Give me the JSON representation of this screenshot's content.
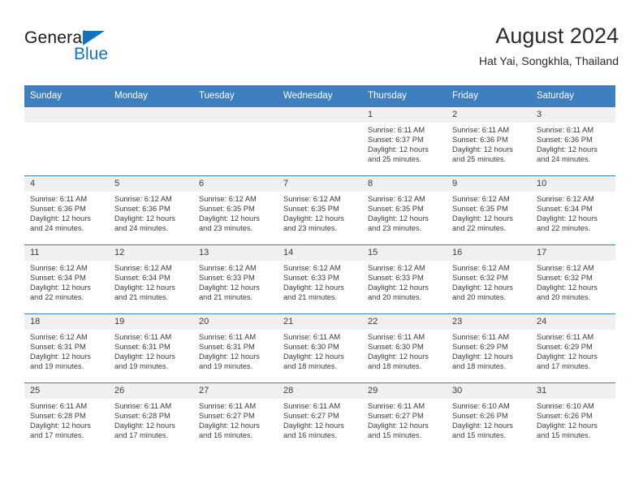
{
  "brand": {
    "name_top": "General",
    "name_bottom": "Blue",
    "accent_color": "#1573be",
    "triangle_icon": "triangle-icon"
  },
  "header": {
    "title": "August 2024",
    "subtitle": "Hat Yai, Songkhla, Thailand"
  },
  "calendar": {
    "header_bg": "#3d7fbf",
    "daynum_bg": "#f0f0f0",
    "weekdays": [
      "Sunday",
      "Monday",
      "Tuesday",
      "Wednesday",
      "Thursday",
      "Friday",
      "Saturday"
    ],
    "weeks": [
      [
        {
          "day": "",
          "lines": []
        },
        {
          "day": "",
          "lines": []
        },
        {
          "day": "",
          "lines": []
        },
        {
          "day": "",
          "lines": []
        },
        {
          "day": "1",
          "lines": [
            "Sunrise: 6:11 AM",
            "Sunset: 6:37 PM",
            "Daylight: 12 hours",
            "and 25 minutes."
          ]
        },
        {
          "day": "2",
          "lines": [
            "Sunrise: 6:11 AM",
            "Sunset: 6:36 PM",
            "Daylight: 12 hours",
            "and 25 minutes."
          ]
        },
        {
          "day": "3",
          "lines": [
            "Sunrise: 6:11 AM",
            "Sunset: 6:36 PM",
            "Daylight: 12 hours",
            "and 24 minutes."
          ]
        }
      ],
      [
        {
          "day": "4",
          "lines": [
            "Sunrise: 6:11 AM",
            "Sunset: 6:36 PM",
            "Daylight: 12 hours",
            "and 24 minutes."
          ]
        },
        {
          "day": "5",
          "lines": [
            "Sunrise: 6:12 AM",
            "Sunset: 6:36 PM",
            "Daylight: 12 hours",
            "and 24 minutes."
          ]
        },
        {
          "day": "6",
          "lines": [
            "Sunrise: 6:12 AM",
            "Sunset: 6:35 PM",
            "Daylight: 12 hours",
            "and 23 minutes."
          ]
        },
        {
          "day": "7",
          "lines": [
            "Sunrise: 6:12 AM",
            "Sunset: 6:35 PM",
            "Daylight: 12 hours",
            "and 23 minutes."
          ]
        },
        {
          "day": "8",
          "lines": [
            "Sunrise: 6:12 AM",
            "Sunset: 6:35 PM",
            "Daylight: 12 hours",
            "and 23 minutes."
          ]
        },
        {
          "day": "9",
          "lines": [
            "Sunrise: 6:12 AM",
            "Sunset: 6:35 PM",
            "Daylight: 12 hours",
            "and 22 minutes."
          ]
        },
        {
          "day": "10",
          "lines": [
            "Sunrise: 6:12 AM",
            "Sunset: 6:34 PM",
            "Daylight: 12 hours",
            "and 22 minutes."
          ]
        }
      ],
      [
        {
          "day": "11",
          "lines": [
            "Sunrise: 6:12 AM",
            "Sunset: 6:34 PM",
            "Daylight: 12 hours",
            "and 22 minutes."
          ]
        },
        {
          "day": "12",
          "lines": [
            "Sunrise: 6:12 AM",
            "Sunset: 6:34 PM",
            "Daylight: 12 hours",
            "and 21 minutes."
          ]
        },
        {
          "day": "13",
          "lines": [
            "Sunrise: 6:12 AM",
            "Sunset: 6:33 PM",
            "Daylight: 12 hours",
            "and 21 minutes."
          ]
        },
        {
          "day": "14",
          "lines": [
            "Sunrise: 6:12 AM",
            "Sunset: 6:33 PM",
            "Daylight: 12 hours",
            "and 21 minutes."
          ]
        },
        {
          "day": "15",
          "lines": [
            "Sunrise: 6:12 AM",
            "Sunset: 6:33 PM",
            "Daylight: 12 hours",
            "and 20 minutes."
          ]
        },
        {
          "day": "16",
          "lines": [
            "Sunrise: 6:12 AM",
            "Sunset: 6:32 PM",
            "Daylight: 12 hours",
            "and 20 minutes."
          ]
        },
        {
          "day": "17",
          "lines": [
            "Sunrise: 6:12 AM",
            "Sunset: 6:32 PM",
            "Daylight: 12 hours",
            "and 20 minutes."
          ]
        }
      ],
      [
        {
          "day": "18",
          "lines": [
            "Sunrise: 6:12 AM",
            "Sunset: 6:31 PM",
            "Daylight: 12 hours",
            "and 19 minutes."
          ]
        },
        {
          "day": "19",
          "lines": [
            "Sunrise: 6:11 AM",
            "Sunset: 6:31 PM",
            "Daylight: 12 hours",
            "and 19 minutes."
          ]
        },
        {
          "day": "20",
          "lines": [
            "Sunrise: 6:11 AM",
            "Sunset: 6:31 PM",
            "Daylight: 12 hours",
            "and 19 minutes."
          ]
        },
        {
          "day": "21",
          "lines": [
            "Sunrise: 6:11 AM",
            "Sunset: 6:30 PM",
            "Daylight: 12 hours",
            "and 18 minutes."
          ]
        },
        {
          "day": "22",
          "lines": [
            "Sunrise: 6:11 AM",
            "Sunset: 6:30 PM",
            "Daylight: 12 hours",
            "and 18 minutes."
          ]
        },
        {
          "day": "23",
          "lines": [
            "Sunrise: 6:11 AM",
            "Sunset: 6:29 PM",
            "Daylight: 12 hours",
            "and 18 minutes."
          ]
        },
        {
          "day": "24",
          "lines": [
            "Sunrise: 6:11 AM",
            "Sunset: 6:29 PM",
            "Daylight: 12 hours",
            "and 17 minutes."
          ]
        }
      ],
      [
        {
          "day": "25",
          "lines": [
            "Sunrise: 6:11 AM",
            "Sunset: 6:28 PM",
            "Daylight: 12 hours",
            "and 17 minutes."
          ]
        },
        {
          "day": "26",
          "lines": [
            "Sunrise: 6:11 AM",
            "Sunset: 6:28 PM",
            "Daylight: 12 hours",
            "and 17 minutes."
          ]
        },
        {
          "day": "27",
          "lines": [
            "Sunrise: 6:11 AM",
            "Sunset: 6:27 PM",
            "Daylight: 12 hours",
            "and 16 minutes."
          ]
        },
        {
          "day": "28",
          "lines": [
            "Sunrise: 6:11 AM",
            "Sunset: 6:27 PM",
            "Daylight: 12 hours",
            "and 16 minutes."
          ]
        },
        {
          "day": "29",
          "lines": [
            "Sunrise: 6:11 AM",
            "Sunset: 6:27 PM",
            "Daylight: 12 hours",
            "and 15 minutes."
          ]
        },
        {
          "day": "30",
          "lines": [
            "Sunrise: 6:10 AM",
            "Sunset: 6:26 PM",
            "Daylight: 12 hours",
            "and 15 minutes."
          ]
        },
        {
          "day": "31",
          "lines": [
            "Sunrise: 6:10 AM",
            "Sunset: 6:26 PM",
            "Daylight: 12 hours",
            "and 15 minutes."
          ]
        }
      ]
    ]
  }
}
